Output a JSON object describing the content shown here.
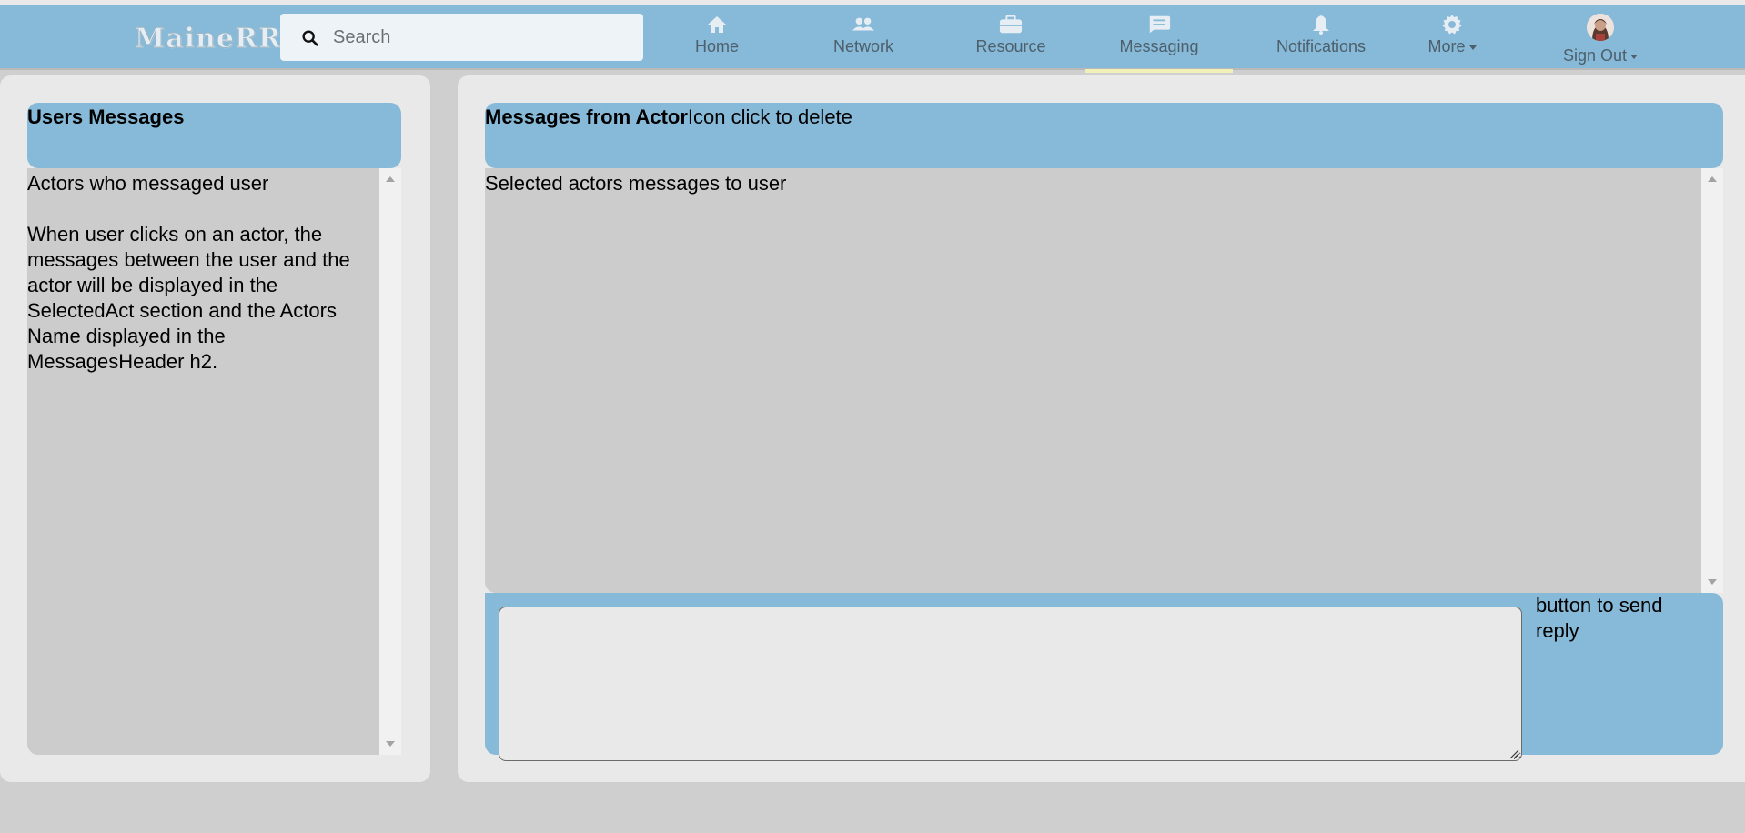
{
  "app": {
    "logo_text": "MaineRR"
  },
  "search": {
    "placeholder": "Search"
  },
  "nav": {
    "items": [
      {
        "label": "Home",
        "icon": "home-icon"
      },
      {
        "label": "Network",
        "icon": "people-icon"
      },
      {
        "label": "Resource",
        "icon": "briefcase-icon"
      },
      {
        "label": "Messaging",
        "icon": "message-icon",
        "active": true
      },
      {
        "label": "Notifications",
        "icon": "bell-icon"
      },
      {
        "label": "More",
        "icon": "gear-icon",
        "dropdown": true
      }
    ],
    "account": {
      "label": "Sign Out",
      "icon": "avatar",
      "dropdown": true
    }
  },
  "left_panel": {
    "header": "Users Messages",
    "body_line1": "Actors who messaged user",
    "body_line2": "When user clicks on an actor, the messages between the user and the actor will be displayed in the SelectedAct section and the Actors Name displayed in the MessagesHeader h2."
  },
  "right_panel": {
    "header": "Messages from Actor",
    "header_note": "Icon click to delete",
    "body": "Selected actors messages to user",
    "reply": {
      "value": "",
      "send_note": "button to send reply"
    }
  },
  "colors": {
    "navbar": "#87bad8",
    "active_underline": "#f1f0b8",
    "panel": "#e9e9e9",
    "content": "#cccccc",
    "page_bg": "#cfcfcf"
  }
}
